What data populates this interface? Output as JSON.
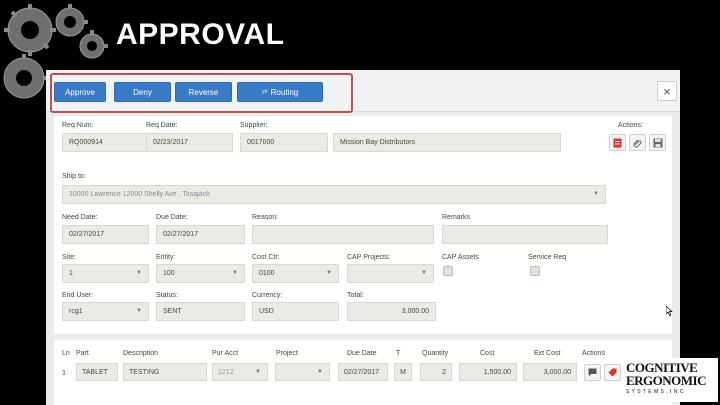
{
  "slide": {
    "title": "APPROVAL"
  },
  "toolbar": {
    "approve": "Approve",
    "deny": "Deny",
    "reverse": "Reverse",
    "routing": "Routing",
    "close": "×"
  },
  "form": {
    "req_num": {
      "label": "Req Num:",
      "value": "RQ000914"
    },
    "req_date": {
      "label": "Req Date:",
      "value": "02/23/2017"
    },
    "supplier": {
      "label": "Supplier:",
      "code": "0017000",
      "name": "Mission Bay Distributors"
    },
    "actions_label": "Actions:",
    "ship_to": {
      "label": "Ship to:",
      "value": "10000 Lawrence 12000 Shelly Ave , Tosajack"
    },
    "need_date": {
      "label": "Need Date:",
      "value": "02/27/2017"
    },
    "due_date": {
      "label": "Due Date:",
      "value": "02/27/2017"
    },
    "reason": {
      "label": "Reason:",
      "value": ""
    },
    "remarks": {
      "label": "Remarks",
      "value": ""
    },
    "site": {
      "label": "Site:",
      "value": "1"
    },
    "entity": {
      "label": "Entity:",
      "value": "100"
    },
    "cost_ctr": {
      "label": "Cost Ctr:",
      "value": "0100"
    },
    "cap_projects": {
      "label": "CAP Projects:",
      "value": ""
    },
    "cap_assets": {
      "label": "CAP Assets"
    },
    "service_req": {
      "label": "Service Req"
    },
    "end_user": {
      "label": "End User:",
      "value": "rcg1"
    },
    "status": {
      "label": "Status:",
      "value": "SENT"
    },
    "currency": {
      "label": "Currency:",
      "value": "USD"
    },
    "total": {
      "label": "Total:",
      "value": "3,000.00"
    }
  },
  "lines": {
    "headers": {
      "ln": "Ln",
      "part": "Part",
      "description": "Description",
      "pur_acct": "Pur Acct",
      "project": "Project",
      "due_date": "Due Date",
      "t": "T",
      "quantity": "Quantity",
      "cost": "Cost",
      "ext_cost": "Ext Cost",
      "actions": "Actions"
    },
    "row": {
      "ln": "1",
      "part": "TABLET",
      "description": "TESTING",
      "pur_acct": "1212",
      "project": "",
      "due_date": "02/27/2017",
      "t": "M",
      "quantity": "2",
      "cost": "1,500.00",
      "ext_cost": "3,000.00"
    }
  },
  "logo": {
    "line1": "COGNITIVE",
    "line2": "ERGONOMIC",
    "line3": "S Y S T E M S , I N C"
  },
  "colors": {
    "primary_button": "#3a7bc8",
    "highlight": "#c0504d",
    "background": "#000000"
  }
}
